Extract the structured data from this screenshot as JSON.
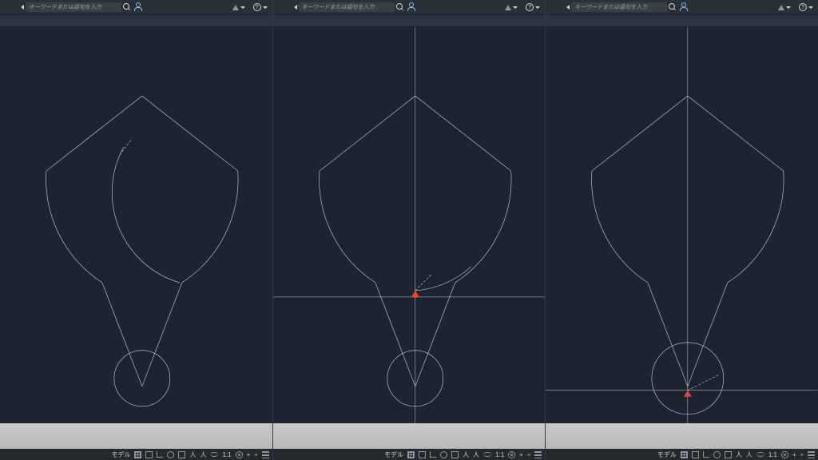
{
  "search": {
    "placeholder": "キーワードまたは語句を入力"
  },
  "topbar": {
    "help_label": "?"
  },
  "status": {
    "model_label": "モデル",
    "scale_label": "1:1",
    "person_glyph": "人",
    "plus_glyph": "+",
    "divide_glyph": "÷"
  }
}
